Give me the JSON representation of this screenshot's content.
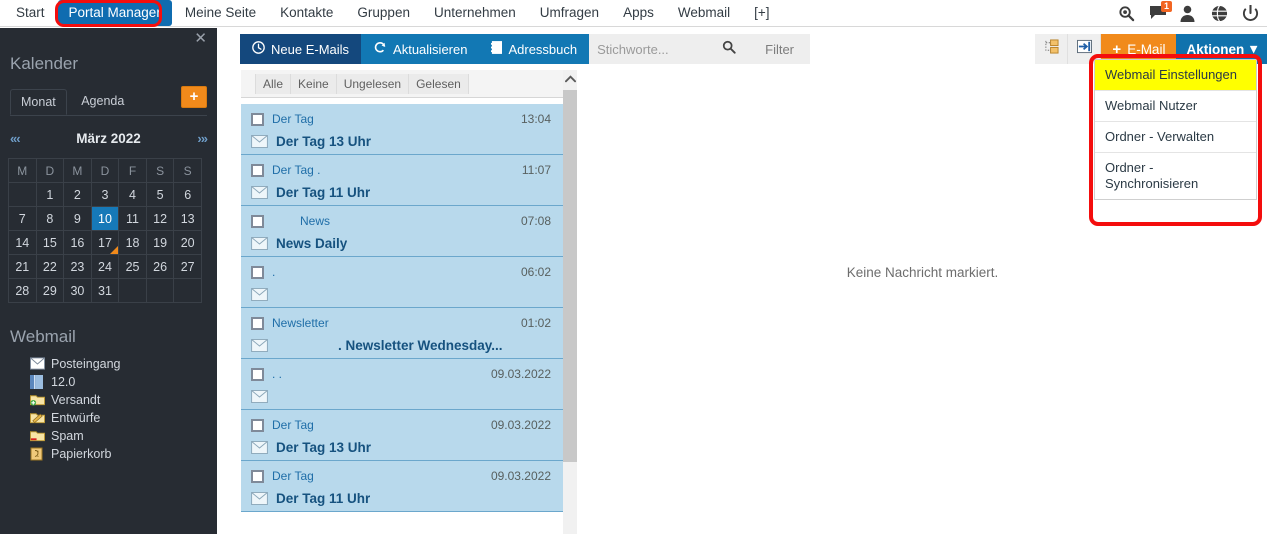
{
  "topnav": {
    "items": [
      {
        "label": "Start",
        "active": false
      },
      {
        "label": "Portal Manager",
        "active": true
      },
      {
        "label": "Meine Seite",
        "active": false
      },
      {
        "label": "Kontakte",
        "active": false
      },
      {
        "label": "Gruppen",
        "active": false
      },
      {
        "label": "Unternehmen",
        "active": false
      },
      {
        "label": "Umfragen",
        "active": false
      },
      {
        "label": "Apps",
        "active": false
      },
      {
        "label": "Webmail",
        "active": false
      },
      {
        "label": "[+]",
        "active": false
      }
    ],
    "icons": [
      {
        "name": "search-icon"
      },
      {
        "name": "chat-icon",
        "badge": "1"
      },
      {
        "name": "user-icon"
      },
      {
        "name": "globe-icon"
      },
      {
        "name": "power-icon"
      }
    ],
    "highlight_color": "#f40d0d",
    "active_color": "#0f6cb0"
  },
  "sidebar": {
    "close_label": "✕",
    "calendar": {
      "title": "Kalender",
      "tabs": [
        {
          "label": "Monat",
          "active": true
        },
        {
          "label": "Agenda",
          "active": false
        }
      ],
      "add_label": "+",
      "prev_label": "«‹",
      "next_label": "›»",
      "month": "März 2022",
      "weekdays": [
        "M",
        "D",
        "M",
        "D",
        "F",
        "S",
        "S"
      ],
      "weeks": [
        [
          {
            "d": ""
          },
          {
            "d": "1"
          },
          {
            "d": "2"
          },
          {
            "d": "3"
          },
          {
            "d": "4"
          },
          {
            "d": "5"
          },
          {
            "d": "6"
          }
        ],
        [
          {
            "d": "7"
          },
          {
            "d": "8"
          },
          {
            "d": "9"
          },
          {
            "d": "10",
            "sel": true
          },
          {
            "d": "11"
          },
          {
            "d": "12"
          },
          {
            "d": "13"
          }
        ],
        [
          {
            "d": "14"
          },
          {
            "d": "15"
          },
          {
            "d": "16"
          },
          {
            "d": "17",
            "mark": true
          },
          {
            "d": "18"
          },
          {
            "d": "19"
          },
          {
            "d": "20"
          }
        ],
        [
          {
            "d": "21"
          },
          {
            "d": "22"
          },
          {
            "d": "23"
          },
          {
            "d": "24"
          },
          {
            "d": "25"
          },
          {
            "d": "26"
          },
          {
            "d": "27"
          }
        ],
        [
          {
            "d": "28"
          },
          {
            "d": "29"
          },
          {
            "d": "30"
          },
          {
            "d": "31"
          },
          {
            "d": ""
          },
          {
            "d": ""
          },
          {
            "d": ""
          }
        ]
      ],
      "selected_day_color": "#1679b8",
      "marker_color": "#f18a1b"
    },
    "webmail": {
      "title": "Webmail",
      "folders": [
        {
          "label": "Posteingang",
          "icon": "inbox-envelope-icon"
        },
        {
          "label": "12.0",
          "icon": "blue-folder-icon"
        },
        {
          "label": "Versandt",
          "icon": "sent-folder-icon"
        },
        {
          "label": "Entwürfe",
          "icon": "drafts-folder-icon"
        },
        {
          "label": "Spam",
          "icon": "spam-folder-icon"
        },
        {
          "label": "Papierkorb",
          "icon": "trash-icon"
        }
      ]
    }
  },
  "toolbar": {
    "new_mails_label": "Neue E-Mails",
    "refresh_label": "Aktualisieren",
    "addressbook_label": "Adressbuch",
    "search_placeholder": "Stichworte...",
    "search_value": "",
    "filter_label": "Filter",
    "tree_icon": "folder-tree-icon",
    "panel_icon": "panel-toggle-icon",
    "email_button_label": "E-Mail",
    "actions_button_label": "Aktionen",
    "actions_caret": "▾",
    "accent_orange": "#f18a1b",
    "accent_blue": "#1072ad"
  },
  "dropdown": {
    "items": [
      {
        "label": "Webmail Einstellungen",
        "highlighted": true
      },
      {
        "label": "Webmail Nutzer",
        "highlighted": false
      },
      {
        "label": "Ordner - Verwalten",
        "highlighted": false
      },
      {
        "label": "Ordner - Synchronisieren",
        "highlighted": false
      }
    ],
    "highlight_bg": "#ffff00",
    "outline_color": "#f40d0d"
  },
  "messagelist": {
    "filters": [
      {
        "label": "Alle"
      },
      {
        "label": "Keine"
      },
      {
        "label": "Ungelesen"
      },
      {
        "label": "Gelesen"
      }
    ],
    "rows": [
      {
        "sender": "Der Tag",
        "sender_indent": false,
        "time": "13:04",
        "subject": "Der Tag 13 Uhr",
        "subject_indent": false
      },
      {
        "sender": "Der Tag            .",
        "sender_indent": false,
        "time": "11:07",
        "subject": "Der Tag 11 Uhr",
        "subject_indent": false
      },
      {
        "sender": "News",
        "sender_indent": true,
        "time": "07:08",
        "subject": "News Daily",
        "subject_indent": false
      },
      {
        "sender": ".",
        "sender_indent": false,
        "time": "06:02",
        "subject": "",
        "subject_indent": false
      },
      {
        "sender": "Newsletter",
        "sender_indent": false,
        "time": "01:02",
        "subject": ". Newsletter Wednesday...",
        "subject_indent": true
      },
      {
        "sender": ".                                 .",
        "sender_indent": false,
        "time": "09.03.2022",
        "subject": "",
        "subject_indent": false
      },
      {
        "sender": "Der Tag",
        "sender_indent": false,
        "time": "09.03.2022",
        "subject": "Der Tag 13 Uhr",
        "subject_indent": false
      },
      {
        "sender": "Der Tag",
        "sender_indent": false,
        "time": "09.03.2022",
        "subject": "Der Tag 11 Uhr",
        "subject_indent": false
      }
    ],
    "row_bg": "#b8d9ec",
    "scroll_up_label": "ⱎ"
  },
  "readingpane": {
    "empty_message": "Keine Nachricht markiert."
  }
}
